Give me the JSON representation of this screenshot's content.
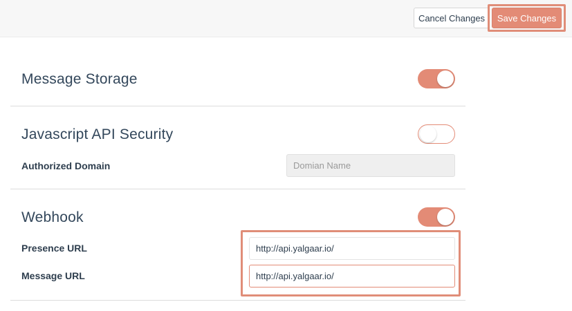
{
  "toolbar": {
    "cancel_label": "Cancel Changes",
    "save_label": "Save Changes"
  },
  "message_storage": {
    "title": "Message Storage",
    "enabled": true
  },
  "js_api_security": {
    "title": "Javascript API Security",
    "enabled": false,
    "authorized_domain_label": "Authorized Domain",
    "authorized_domain_placeholder": "Domian Name",
    "authorized_domain_value": ""
  },
  "webhook": {
    "title": "Webhook",
    "enabled": true,
    "presence_url_label": "Presence URL",
    "presence_url_value": "http://api.yalgaar.io/",
    "message_url_label": "Message URL",
    "message_url_value": "http://api.yalgaar.io/"
  },
  "colors": {
    "accent": "#e38b76",
    "highlight_outline": "#e08d78",
    "text": "#2e3e4e"
  }
}
